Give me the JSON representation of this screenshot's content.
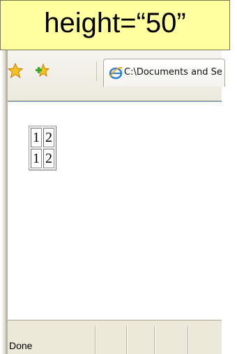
{
  "annotation": {
    "text": "height=“50”"
  },
  "toolbar": {
    "favorites_icon": "star-icon",
    "add_favorites_icon": "add-favorites-icon",
    "tab": {
      "icon": "ie-page-icon",
      "title": "C:\\Documents and Settings"
    }
  },
  "table": {
    "rows": [
      [
        "1",
        "2"
      ],
      [
        "1",
        "2"
      ]
    ]
  },
  "statusbar": {
    "text": "Done"
  },
  "colors": {
    "callout": "#ffff9f",
    "chrome": "#ece9d8"
  }
}
